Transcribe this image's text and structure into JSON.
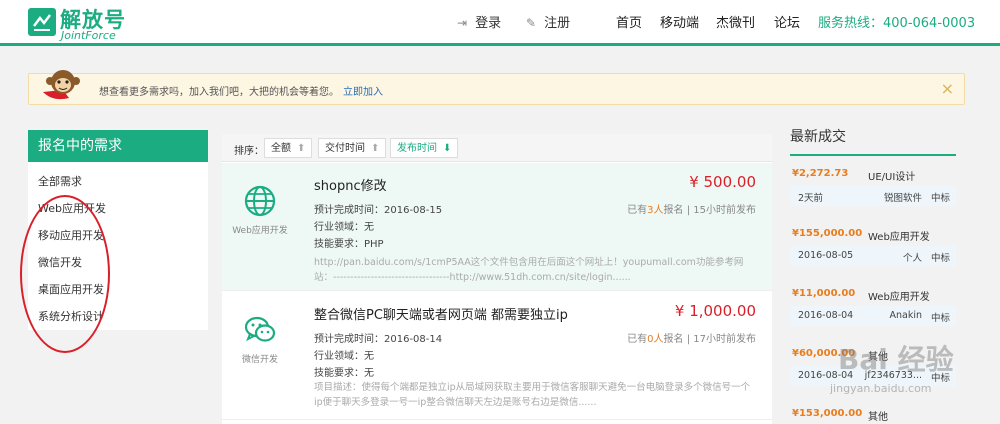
{
  "header": {
    "logo_cn": "解放号",
    "logo_en": "JointForce",
    "login": "登录",
    "register": "注册",
    "nav": [
      "首页",
      "移动端",
      "杰微刊",
      "论坛"
    ],
    "hotline": "服务热线：400-064-0003",
    "accent": "#1bac82"
  },
  "notice": {
    "text": "想查看更多需求吗，加入我们吧，大把的机会等着您。",
    "link": "立即加入",
    "close": "×"
  },
  "sidebar": {
    "title": "报名中的需求",
    "items": [
      "全部需求",
      "Web应用开发",
      "移动应用开发",
      "微信开发",
      "桌面应用开发",
      "系统分析设计"
    ]
  },
  "sortbar": {
    "label": "排序：",
    "options": [
      {
        "label": "全额",
        "arrow": "⬆"
      },
      {
        "label": "交付时间",
        "arrow": "⬆"
      },
      {
        "label": "发布时间",
        "arrow": "⬇"
      }
    ]
  },
  "tasks": [
    {
      "category": "Web应用开发",
      "icon": "globe-icon",
      "title": "shopnc修改",
      "price": "¥ 500.00",
      "deadline": "预计完成时间：2016-08-15",
      "industry": "行业领域：无",
      "skill": "技能要求：PHP",
      "stat_pre": "已有",
      "stat_num": "3人",
      "stat_post": "报名 | 15小时前发布",
      "desc": "http://pan.baidu.com/s/1cmP5AA这个文件包含用在后面这个网址上！youpumall.com功能参考网站：----------------------------------http://www.51dh.com.cn/site/login......"
    },
    {
      "category": "微信开发",
      "icon": "wechat-icon",
      "title": "整合微信PC聊天端或者网页端 都需要独立ip",
      "price": "¥ 1,000.00",
      "deadline": "预计完成时间：2016-08-14",
      "industry": "行业领域：无",
      "skill": "技能要求：无",
      "stat_pre": "已有",
      "stat_num": "0人",
      "stat_post": "报名 | 17小时前发布",
      "desc": "项目描述：使得每个端都是独立ip从局域网获取主要用于微信客服聊天避免一台电脑登录多个微信号一个ip便于聊天多登录一号一ip整合微信聊天左边是账号右边是微信......"
    }
  ],
  "deals": {
    "title": "最新成交",
    "items": [
      {
        "amount": "¥2,272.73",
        "type": "UE/UI设计",
        "date": "2天前",
        "user": "锐图软件",
        "status": "中标"
      },
      {
        "amount": "¥155,000.00",
        "type": "Web应用开发",
        "date": "2016-08-05",
        "user": "个人",
        "status": "中标"
      },
      {
        "amount": "¥11,000.00",
        "type": "Web应用开发",
        "date": "2016-08-04",
        "user": "Anakin",
        "status": "中标"
      },
      {
        "amount": "¥60,000.00",
        "type": "其他",
        "date": "2016-08-04",
        "user": "jf2346733...",
        "status": "中标"
      },
      {
        "amount": "¥153,000.00",
        "type": "其他",
        "date": "",
        "user": "",
        "status": ""
      }
    ]
  },
  "watermark": {
    "text": "Bai 经验",
    "sub": "jingyan.baidu.com"
  }
}
